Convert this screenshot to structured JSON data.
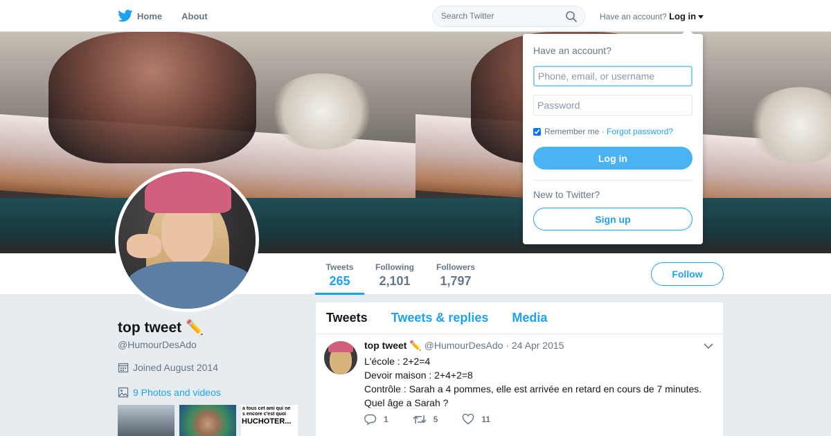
{
  "nav": {
    "home_label": "Home",
    "about_label": "About",
    "search_placeholder": "Search Twitter",
    "have_account": "Have an account?",
    "login_label": "Log in"
  },
  "profile": {
    "name": "top tweet ✏️",
    "handle": "@HumourDesAdo",
    "joined": "Joined August 2014",
    "photos_link": "9 Photos and videos",
    "thumb3_caption_1": "a tous cet ami qui ne",
    "thumb3_caption_2": "s encore c'est quoi",
    "thumb3_caption_big": "HUCHOTER...",
    "stats": [
      {
        "label": "Tweets",
        "value": "265"
      },
      {
        "label": "Following",
        "value": "2,101"
      },
      {
        "label": "Followers",
        "value": "1,797"
      }
    ],
    "follow_label": "Follow"
  },
  "timeline": {
    "tabs": [
      "Tweets",
      "Tweets & replies",
      "Media"
    ],
    "tweet": {
      "name": "top tweet ✏️",
      "handle": "@HumourDesAdo",
      "date": "· 24 Apr 2015",
      "lines": [
        "L'école : 2+2=4",
        "Devoir maison : 2+4+2=8",
        "Contrôle : Sarah a 4 pommes, elle est arrivée en retard en cours de 7 minutes.",
        "Quel âge a Sarah ?"
      ],
      "replies": "1",
      "retweets": "5",
      "likes": "11"
    }
  },
  "login_dropdown": {
    "title": "Have an account?",
    "username_placeholder": "Phone, email, or username",
    "password_placeholder": "Password",
    "remember_label": "Remember me",
    "separator": " · ",
    "forgot_label": "Forgot password?",
    "login_button": "Log in",
    "new_label": "New to Twitter?",
    "signup_button": "Sign up"
  },
  "colors": {
    "accent": "#1da1f2",
    "login_button": "#4ab3f4",
    "background": "#e6ecf0"
  }
}
